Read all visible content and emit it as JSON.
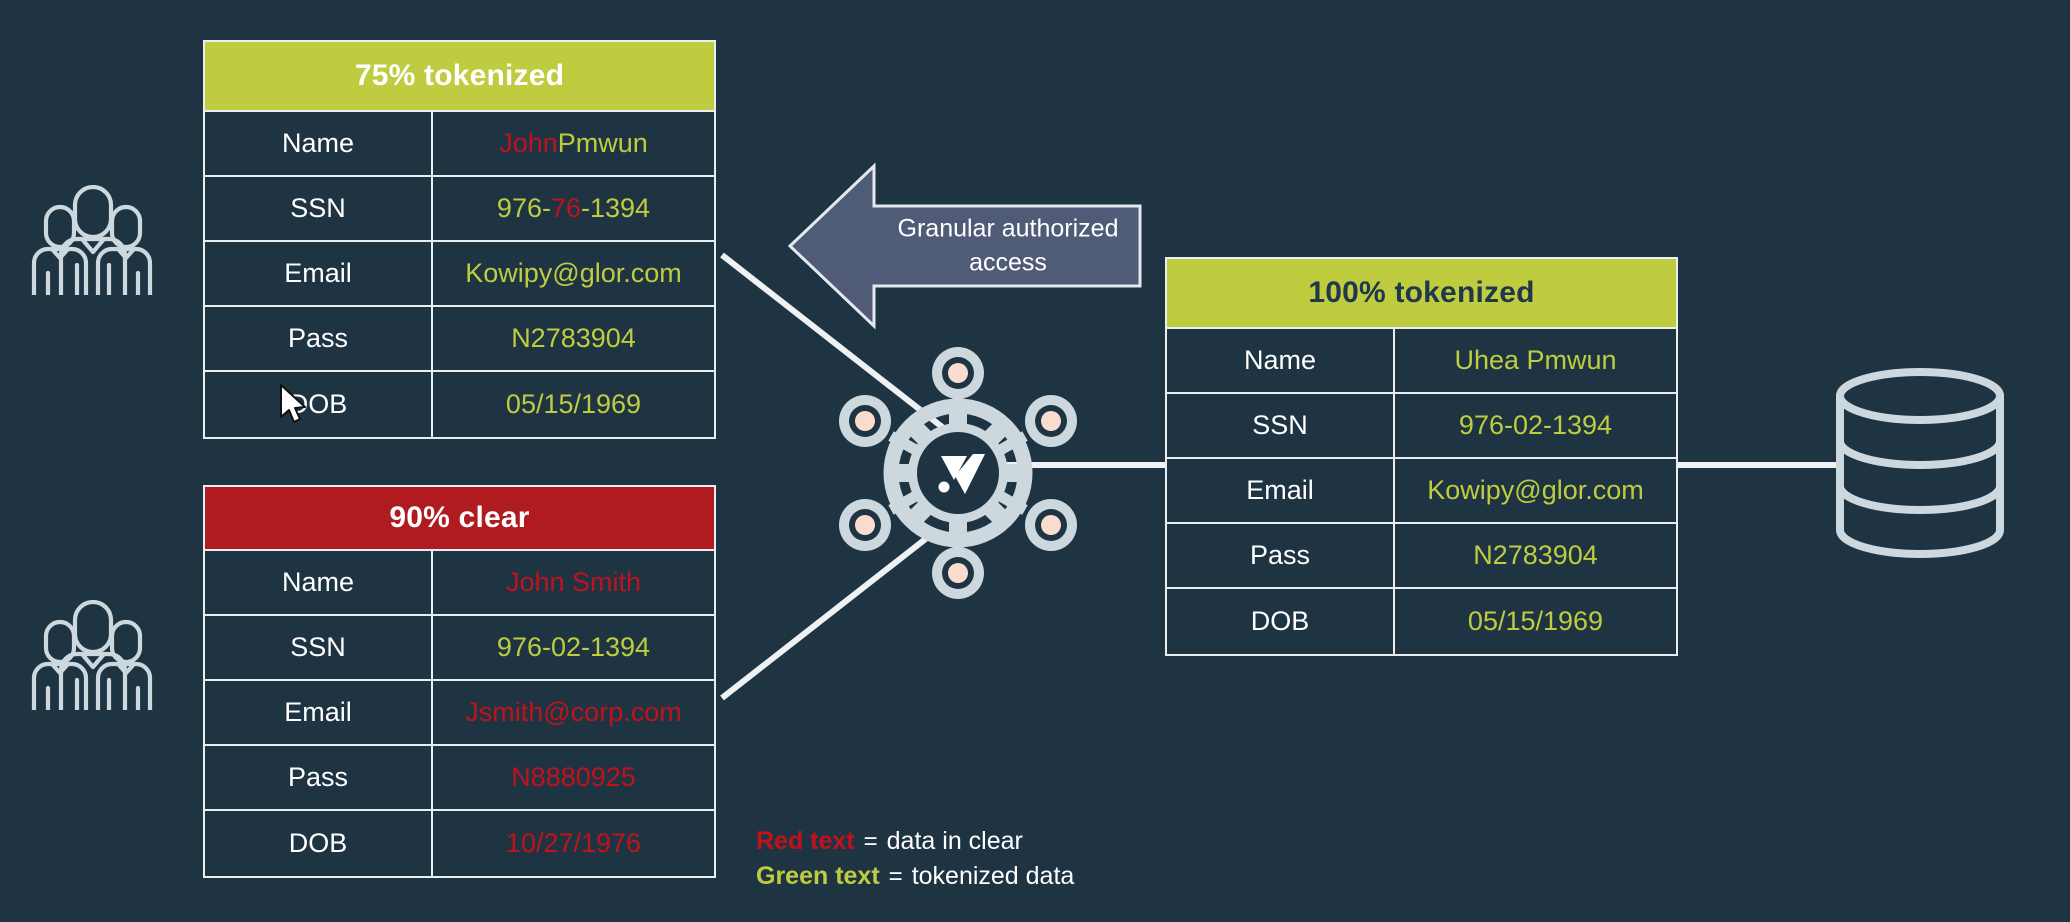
{
  "background_color": "#1e3443",
  "palette": {
    "green": "#bfcc40",
    "red": "#af1b1e",
    "red_text": "#c1121c",
    "line": "#eef2f4",
    "icon_outline": "#ccd8dd",
    "arrow_fill": "#505c77",
    "node_center": "#f9dccd"
  },
  "tables": [
    {
      "id": "table-75-tokenized",
      "header": "75% tokenized",
      "header_style": "green",
      "header_text_color": "white",
      "rows": [
        {
          "label": "Name",
          "segments": [
            {
              "text": "John",
              "color": "red"
            },
            {
              "text": " Pmwun",
              "color": "green"
            }
          ]
        },
        {
          "label": "SSN",
          "segments": [
            {
              "text": "976-",
              "color": "green"
            },
            {
              "text": "76",
              "color": "red"
            },
            {
              "text": "-1394",
              "color": "green"
            }
          ]
        },
        {
          "label": "Email",
          "segments": [
            {
              "text": "Kowipy@glor.com",
              "color": "green"
            }
          ]
        },
        {
          "label": "Pass",
          "segments": [
            {
              "text": "N2783904",
              "color": "green"
            }
          ]
        },
        {
          "label": "DOB",
          "segments": [
            {
              "text": "05/15/1969",
              "color": "green"
            }
          ]
        }
      ]
    },
    {
      "id": "table-90-clear",
      "header": "90% clear",
      "header_style": "red",
      "header_text_color": "white",
      "rows": [
        {
          "label": "Name",
          "segments": [
            {
              "text": "John Smith",
              "color": "red"
            }
          ]
        },
        {
          "label": "SSN",
          "segments": [
            {
              "text": "976-02-1394",
              "color": "green"
            }
          ]
        },
        {
          "label": "Email",
          "segments": [
            {
              "text": "Jsmith@corp.com",
              "color": "red"
            }
          ]
        },
        {
          "label": "Pass",
          "segments": [
            {
              "text": "N8880925",
              "color": "red"
            }
          ]
        },
        {
          "label": "DOB",
          "segments": [
            {
              "text": "10/27/1976",
              "color": "red"
            }
          ]
        }
      ]
    },
    {
      "id": "table-100-tokenized",
      "header": "100% tokenized",
      "header_style": "green",
      "header_text_color": "dark",
      "rows": [
        {
          "label": "Name",
          "segments": [
            {
              "text": "Uhea Pmwun",
              "color": "green"
            }
          ]
        },
        {
          "label": "SSN",
          "segments": [
            {
              "text": "976-02-1394",
              "color": "green"
            }
          ]
        },
        {
          "label": "Email",
          "segments": [
            {
              "text": "Kowipy@glor.com",
              "color": "green"
            }
          ]
        },
        {
          "label": "Pass",
          "segments": [
            {
              "text": "N2783904",
              "color": "green"
            }
          ]
        },
        {
          "label": "DOB",
          "segments": [
            {
              "text": "05/15/1969",
              "color": "green"
            }
          ]
        }
      ]
    }
  ],
  "arrow_banner": {
    "line1": "Granular authorized",
    "line2": "access",
    "direction": "left"
  },
  "legend": {
    "rows": [
      {
        "key": "Red text",
        "key_color": "red",
        "equals": "=",
        "desc": "data in clear"
      },
      {
        "key": "Green text",
        "key_color": "green",
        "equals": "=",
        "desc": "tokenized data"
      }
    ]
  },
  "icons": {
    "people_top": "people-group-icon",
    "people_bottom": "people-group-icon",
    "hub": "tokenization-hub-icon",
    "database": "database-cylinder-icon",
    "cursor": "mouse-pointer-cursor"
  },
  "hub": {
    "node_count": 6,
    "logo": "vault-v-logo"
  }
}
